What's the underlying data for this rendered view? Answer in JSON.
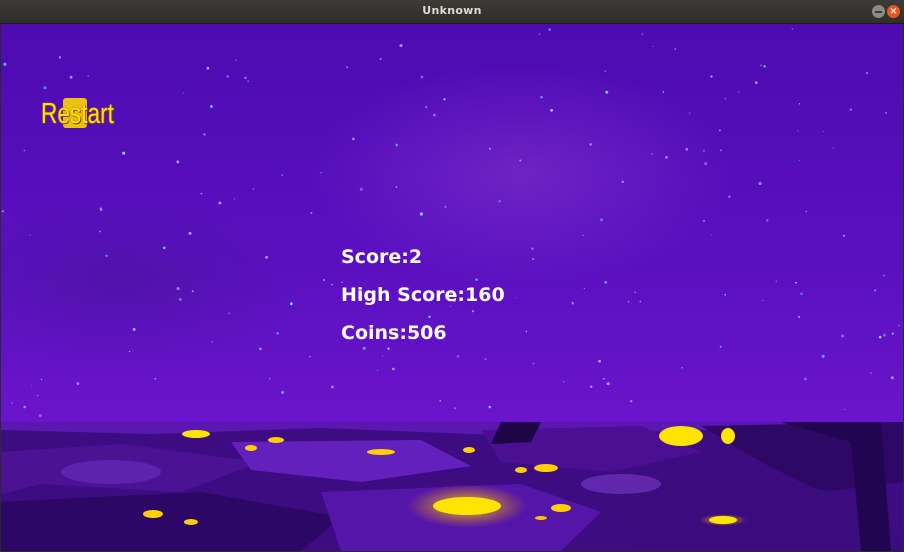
{
  "window": {
    "title": "Unknown"
  },
  "hud": {
    "restart_label": "Restart"
  },
  "stats": {
    "score": "Score:2",
    "high_score": "High Score:160",
    "coins": "Coins:506"
  },
  "colors": {
    "sky": "#5a10bf",
    "restart_text": "#ffe100",
    "lava_glow": "#ffe400",
    "ground": "#3a0a7a"
  }
}
